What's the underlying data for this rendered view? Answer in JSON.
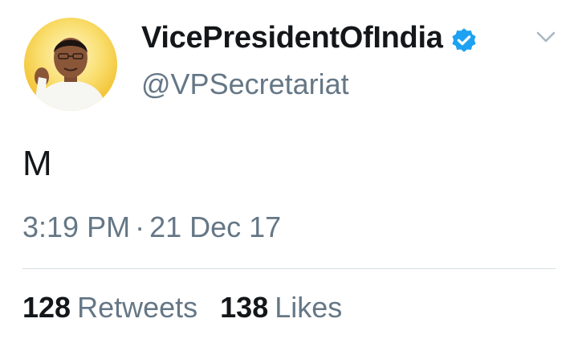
{
  "tweet": {
    "author": {
      "display_name": "VicePresidentOfIndia",
      "handle": "@VPSecretariat",
      "verified": true,
      "avatar_icon": "profile-photo"
    },
    "text": "M",
    "time": "3:19 PM",
    "separator": "·",
    "date": "21 Dec 17",
    "stats": {
      "retweets_count": "128",
      "retweets_label": "Retweets",
      "likes_count": "138",
      "likes_label": "Likes"
    }
  },
  "colors": {
    "primary_text": "#14171a",
    "secondary_text": "#657786",
    "verified_blue": "#1da1f2",
    "divider": "#d6dce0"
  }
}
